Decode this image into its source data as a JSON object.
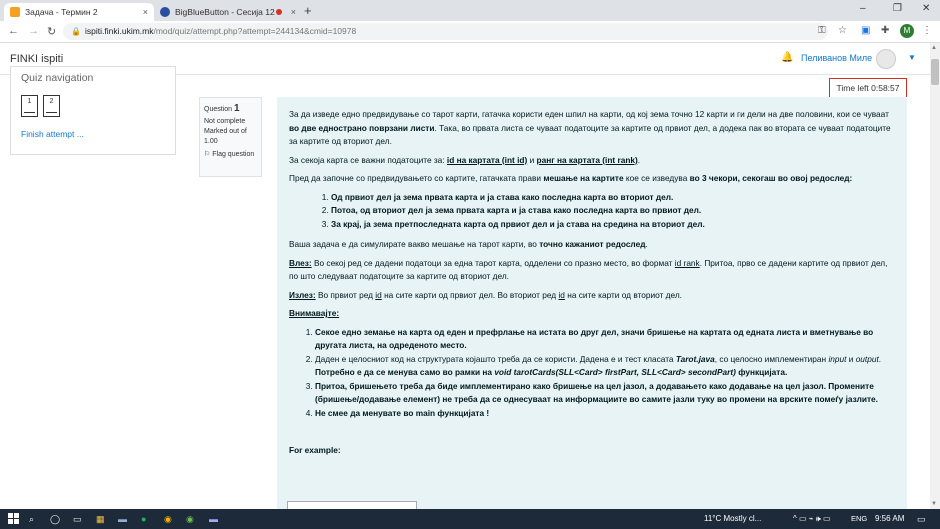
{
  "browser": {
    "tabs": [
      {
        "label": "Задача - Термин 2",
        "close": "×"
      },
      {
        "label": "BigBlueButton - Сесија 12",
        "close": "×"
      }
    ],
    "new_tab": "+",
    "window_controls": {
      "minimize": "–",
      "maximize": "❐",
      "close": "✕"
    },
    "url_host": "ispiti.finki.ukim.mk",
    "url_path": "/mod/quiz/attempt.php?attempt=244134&cmid=10978",
    "profile_letter": "M",
    "colors": {
      "tabbar": "#dee1e6",
      "profile": "#2e7d32"
    }
  },
  "header": {
    "site_name": "FINKI ispiti",
    "user_name": "Пеливанов Миле"
  },
  "quiz_nav": {
    "title": "Quiz navigation",
    "questions": [
      "1",
      "2"
    ],
    "finish_link": "Finish attempt ..."
  },
  "timer": {
    "label": "Time left 0:58:57"
  },
  "question_info": {
    "label": "Question",
    "number": "1",
    "status": "Not complete",
    "marked": "Marked out of 1.00",
    "flag": "Flag question"
  },
  "content": {
    "p1_a": "За да изведе едно предвидување со тарот карти, гатачка користи еден шпил на карти, од кој зема точно 12  карти и ги дели на две половини, кои се чуваат ",
    "p1_b": "во две едностранo поврзани листи",
    "p1_c": ". Така, во првата листа се чуваат податоците за картите од првиот дел, а додека пак во втората се чуваат податоците за картите од вториот дел.",
    "p2_a": "За секоја карта се важни податоците за: ",
    "p2_b": "id на картата (int id)",
    "p2_c": " и ",
    "p2_d": "ранг на картата (int rank)",
    "p2_e": ".",
    "p3_a": "Пред да започне со предвидувањето со картите, гатачката прави ",
    "p3_b": "мешање на картите",
    "p3_c": " кое се изведува ",
    "p3_d": "во 3 чекори, секогаш во овој редослед:",
    "steps": [
      "Од првиот дел ја зема првата карта и ја става како последна карта во вториот дел.",
      "Потоа, од вториот дел ја зема првата карта и ја става како последна карта во првиот дел.",
      "За крај, ја зема претпоследната карта од првиот дел и ја става на средина на вториот дел."
    ],
    "p4_a": "Ваша задача е да симулирате вакво мешање на тарот карти, во ",
    "p4_b": "точно кажаниот редослед",
    "p4_c": ".",
    "input_label": "Влез:",
    "input_a": " Во секој ред се дадени податоци за една тарот карта, одделени со празно место, во формат ",
    "input_b": "id rank",
    "input_c": ". Притоа, прво се дадени картите од првиот дел, по што следуваат податоците за картите од вториот дел.",
    "output_label": "Излез:",
    "output_a": " Во првиот ред ",
    "output_b": "id",
    "output_c": " на сите карти од првиот дел. Во вториот ред ",
    "output_d": "id",
    "output_e": " на сите карти од вториот дел.",
    "attention": "Внимавајте:",
    "note1": "Секое едно земање на карта од еден и префрлање на истата во друг дел, значи бришење на картата од едната листа и вметнување во другата листа, на одреденото место.",
    "note2_a": "Даден е целосниот код на структурата којашто треба да се користи. Дадена е и тест класата ",
    "note2_b": "Tarot.java",
    "note2_c": ", со целосно имплементиран ",
    "note2_d": "input",
    "note2_e": " и ",
    "note2_f": "output",
    "note2_g": ". ",
    "note2_h": "Потребно е да се менува само во рамки на ",
    "note2_i": "void tarotCards(SLL<Card> firstPart, SLL<Card> secondPart)",
    "note2_j": " функцијата.",
    "note3": "Притоа, бришењето треба да биде имплементирано како бришење на цел јазол, а додавањето како додавање на цел јазол. Промените (бришење/додавање елемент) не треба да се однесуваат на информациите во самите јазли туку во промени на врските помеѓу јазлите.",
    "note4": "Не смее да менувате во main функцијата !",
    "example": "For example:",
    "bg_color": "#e7f3f5"
  },
  "taskbar": {
    "weather": "11°C  Mostly cl...",
    "lang": "ENG",
    "time": "9:56 AM"
  }
}
